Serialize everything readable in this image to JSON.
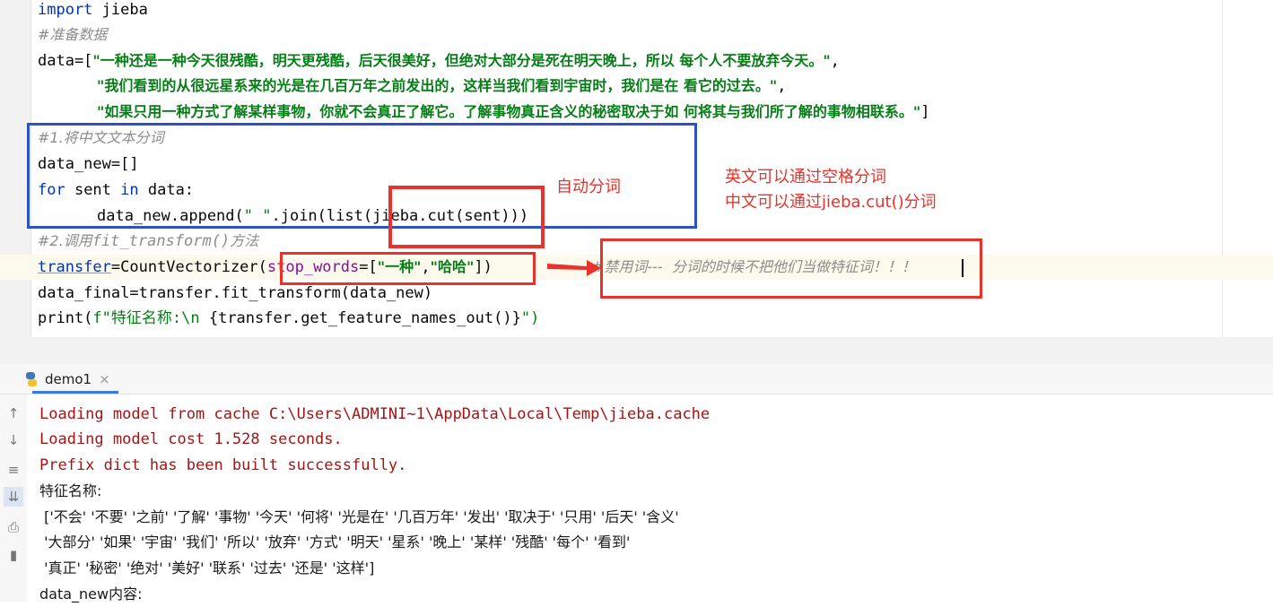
{
  "editor": {
    "lines": {
      "l1_kw": "import",
      "l1_rest": " jieba",
      "l2": "#准备数据",
      "l3_a": "data=[",
      "l3_b": "\"一种还是一种今天很残酷，明天更残酷，后天很美好，但绝对大部分是死在明天晚上，所以 每个人不要放弃今天。\"",
      "l3_c": ",",
      "l4_b": "\"我们看到的从很远星系来的光是在几百万年之前发出的，这样当我们看到宇宙时，我们是在 看它的过去。\"",
      "l4_c": ",",
      "l5_b": "\"如果只用一种方式了解某样事物，你就不会真正了解它。了解事物真正含义的秘密取决于如 何将其与我们所了解的事物相联系。\"",
      "l5_c": "]",
      "l6": "#1.将中文文本分词",
      "l7": "data_new=[]",
      "l8_kw1": "for",
      "l8_mid": " sent ",
      "l8_kw2": "in",
      "l8_rest": " data:",
      "l9_a": "data_new.append(",
      "l9_str": "\" \"",
      "l9_b": ".join(list(jieba.cut(sent)))",
      "l10_a": "#2.调用",
      "l10_b": "fit_transform()",
      "l10_c": "方法",
      "l11_transfer": "transfer",
      "l11_a": "=CountVectorizer(",
      "l11_param": "stop_words",
      "l11_b": "=[",
      "l11_s1": "\"一种\"",
      "l11_comma": ",",
      "l11_s2": "\"哈哈\"",
      "l11_c": "])",
      "l11_comment": "#禁用词---  分词的时候不把他们当做特征词！！！",
      "l12": "data_final=transfer.fit_transform(data_new)",
      "l13_a": "print(",
      "l13_str": "f\"特征名称:\\n ",
      "l13_b": "{transfer.get_feature_names_out()}",
      "l13_c": "\")"
    }
  },
  "annotations": {
    "auto_seg": "自动分词",
    "note_line1": "英文可以通过空格分词",
    "note_line2": "中文可以通过jieba.cut()分词"
  },
  "run_tab": {
    "label": "demo1",
    "close": "×"
  },
  "console": {
    "lines": [
      "Loading model from cache C:\\Users\\ADMINI~1\\AppData\\Local\\Temp\\jieba.cache",
      "Loading model cost 1.528 seconds.",
      "Prefix dict has been built successfully.",
      "特征名称:",
      " ['不会' '不要' '之前' '了解' '事物' '今天' '何将' '光是在' '几百万年' '发出' '取决于' '只用' '后天' '含义'",
      " '大部分' '如果' '宇宙' '我们' '所以' '放弃' '方式' '明天' '星系' '晚上' '某样' '残酷' '每个' '看到'",
      " '真正' '秘密' '绝对' '美好' '联系' '过去' '还是' '这样']",
      "data_new内容:"
    ]
  },
  "colors": {
    "red_box": "#e8322b",
    "blue_box": "#2d52c8",
    "console_red": "#a31515"
  },
  "icons": [
    "arrow-up-icon",
    "arrow-down-icon",
    "soft-wrap-icon",
    "scroll-end-icon",
    "print-icon",
    "trash-icon",
    "python-icon",
    "red-arrow-icon"
  ]
}
